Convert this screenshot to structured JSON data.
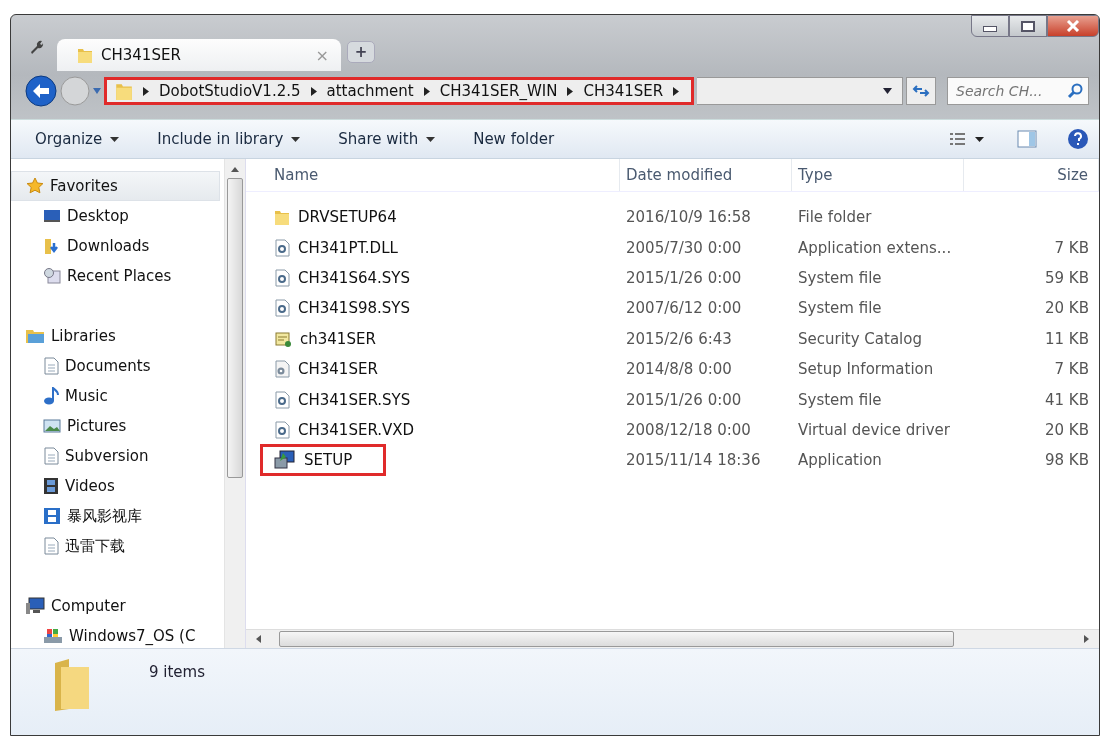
{
  "window": {
    "tab": {
      "title": "CH341SER",
      "close": "×",
      "new_tab": "+"
    }
  },
  "address_bar": {
    "highlighted": true,
    "crumbs": [
      "DobotStudioV1.2.5",
      "attachment",
      "CH341SER_WIN",
      "CH341SER"
    ]
  },
  "search": {
    "placeholder": "Search CH..."
  },
  "toolbar": {
    "buttons": [
      {
        "label": "Organize",
        "dropdown": true
      },
      {
        "label": "Include in library",
        "dropdown": true
      },
      {
        "label": "Share with",
        "dropdown": true
      },
      {
        "label": "New folder",
        "dropdown": false
      }
    ]
  },
  "navigation": [
    {
      "label": "Favorites",
      "kind": "star",
      "selected": true,
      "children": [
        {
          "label": "Desktop",
          "kind": "desktop",
          "selected": false
        },
        {
          "label": "Downloads",
          "kind": "downloads",
          "selected": false
        },
        {
          "label": "Recent Places",
          "kind": "recent",
          "selected": false
        }
      ]
    },
    {
      "label": "Libraries",
      "kind": "library",
      "selected": false,
      "children": [
        {
          "label": "Documents",
          "kind": "document",
          "selected": false
        },
        {
          "label": "Music",
          "kind": "music",
          "selected": false
        },
        {
          "label": "Pictures",
          "kind": "pictures",
          "selected": false
        },
        {
          "label": "Subversion",
          "kind": "document",
          "selected": false
        },
        {
          "label": "Videos",
          "kind": "video",
          "selected": false
        },
        {
          "label": "暴风影视库",
          "kind": "video-library",
          "selected": false
        },
        {
          "label": "迅雷下载",
          "kind": "document",
          "selected": false
        }
      ]
    },
    {
      "label": "Computer",
      "kind": "computer",
      "selected": false,
      "children": [
        {
          "label": "Windows7_OS (C",
          "kind": "drive",
          "selected": false
        }
      ]
    }
  ],
  "table": {
    "columns": [
      "Name",
      "Date modified",
      "Type",
      "Size"
    ],
    "rows": [
      {
        "name": "DRVSETUP64",
        "kind": "folder",
        "date": "2016/10/9 16:58",
        "type": "File folder",
        "size": "",
        "highlighted": false
      },
      {
        "name": "CH341PT.DLL",
        "kind": "system",
        "date": "2005/7/30 0:00",
        "type": "Application extens...",
        "size": "7 KB",
        "highlighted": false
      },
      {
        "name": "CH341S64.SYS",
        "kind": "system",
        "date": "2015/1/26 0:00",
        "type": "System file",
        "size": "59 KB",
        "highlighted": false
      },
      {
        "name": "CH341S98.SYS",
        "kind": "system",
        "date": "2007/6/12 0:00",
        "type": "System file",
        "size": "20 KB",
        "highlighted": false
      },
      {
        "name": "ch341SER",
        "kind": "catalog",
        "date": "2015/2/6 6:43",
        "type": "Security Catalog",
        "size": "11 KB",
        "highlighted": false
      },
      {
        "name": "CH341SER",
        "kind": "setup-info",
        "date": "2014/8/8 0:00",
        "type": "Setup Information",
        "size": "7 KB",
        "highlighted": false
      },
      {
        "name": "CH341SER.SYS",
        "kind": "system",
        "date": "2015/1/26 0:00",
        "type": "System file",
        "size": "41 KB",
        "highlighted": false
      },
      {
        "name": "CH341SER.VXD",
        "kind": "system",
        "date": "2008/12/18 0:00",
        "type": "Virtual device driver",
        "size": "20 KB",
        "highlighted": false
      },
      {
        "name": "SETUP",
        "kind": "application",
        "date": "2015/11/14 18:36",
        "type": "Application",
        "size": "98 KB",
        "highlighted": true
      }
    ]
  },
  "status_bar": {
    "count": "9 items"
  }
}
